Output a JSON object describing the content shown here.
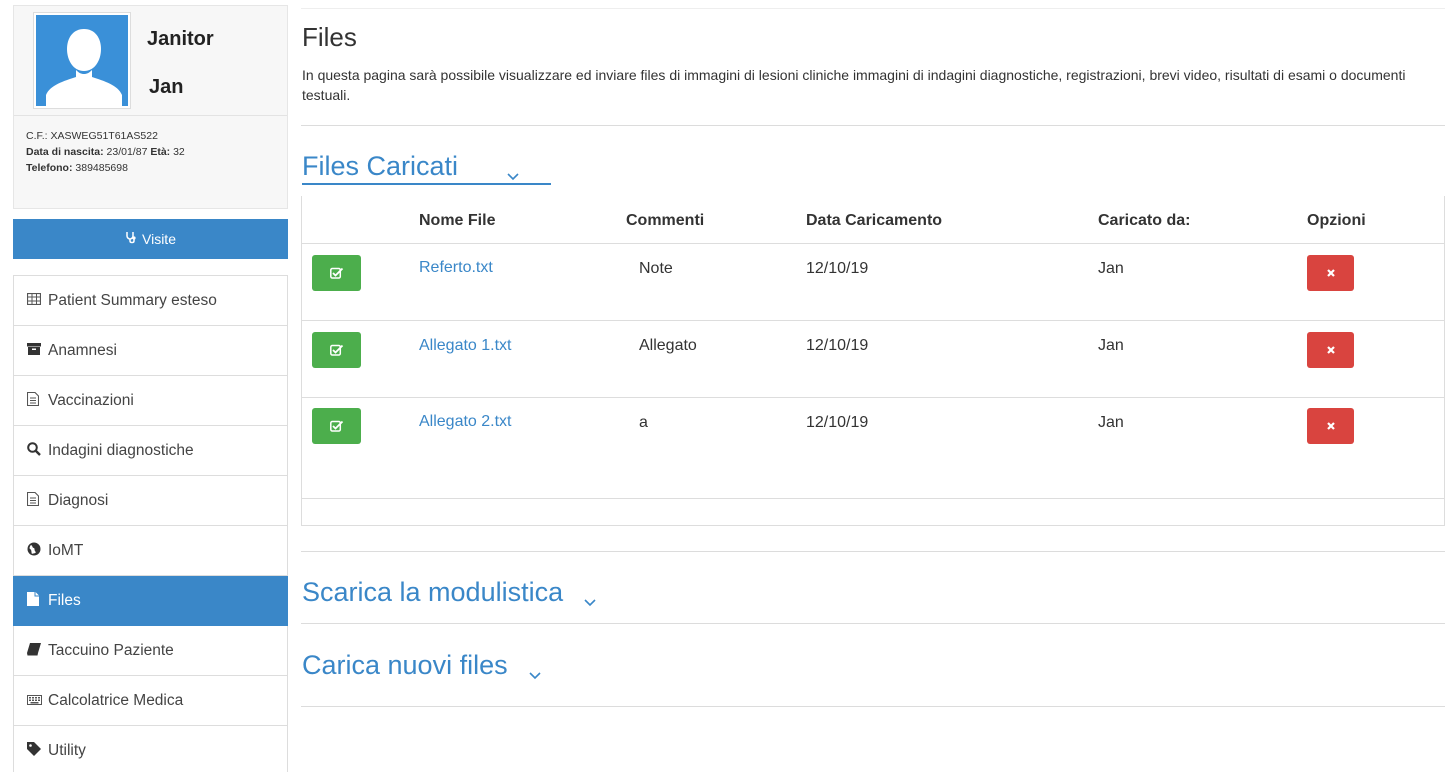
{
  "patient": {
    "first_name": "Janitor",
    "last_name": "Jan",
    "cf_label": "C.F.:",
    "cf_value": "XASWEG51T61AS522",
    "dob_label": "Data di nascita:",
    "dob_value": "23/01/87",
    "age_label": "Età:",
    "age_value": "32",
    "phone_label": "Telefono:",
    "phone_value": "389485698"
  },
  "sidebar": {
    "visite_label": "Visite",
    "items": [
      {
        "label": "Patient Summary esteso",
        "icon": "table-icon"
      },
      {
        "label": "Anamnesi",
        "icon": "archive-icon"
      },
      {
        "label": "Vaccinazioni",
        "icon": "document-icon"
      },
      {
        "label": "Indagini diagnostiche",
        "icon": "search-icon"
      },
      {
        "label": "Diagnosi",
        "icon": "document-icon"
      },
      {
        "label": "IoMT",
        "icon": "globe-icon"
      },
      {
        "label": "Files",
        "icon": "file-icon",
        "active": true
      },
      {
        "label": "Taccuino Paziente",
        "icon": "book-icon"
      },
      {
        "label": "Calcolatrice Medica",
        "icon": "keyboard-icon"
      },
      {
        "label": "Utility",
        "icon": "tag-icon"
      }
    ]
  },
  "main": {
    "title": "Files",
    "description": "In questa pagina sarà possibile visualizzare ed inviare files di immagini di lesioni cliniche immagini di indagini diagnostiche, registrazioni, brevi video, risultati di esami o documenti testuali.",
    "section_uploaded": "Files Caricati",
    "section_download": "Scarica la modulistica",
    "section_upload": "Carica nuovi files",
    "table": {
      "headers": {
        "name": "Nome File",
        "comments": "Commenti",
        "date": "Data Caricamento",
        "uploader": "Caricato da:",
        "options": "Opzioni"
      },
      "rows": [
        {
          "name": "Referto.txt",
          "comment": "Note",
          "date": "12/10/19",
          "uploader": "Jan"
        },
        {
          "name": "Allegato 1.txt",
          "comment": "Allegato",
          "date": "12/10/19",
          "uploader": "Jan"
        },
        {
          "name": "Allegato 2.txt",
          "comment": "a",
          "date": "12/10/19",
          "uploader": "Jan"
        }
      ]
    }
  },
  "colors": {
    "primary": "#3a87c8",
    "success": "#4cae4c",
    "danger": "#d9443f"
  }
}
